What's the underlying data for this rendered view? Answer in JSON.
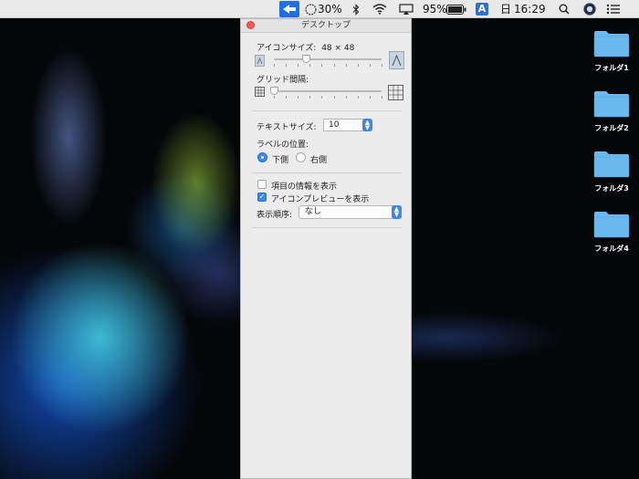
{
  "colors": {
    "accent": "#3d86e8",
    "menubar": "#e9e9e9",
    "panel": "#ececec",
    "close": "#ec5b56",
    "folder": "#6bb8f1"
  },
  "menubar": {
    "app_icon": "arrow-icon",
    "battery_percent_1": "30%",
    "bluetooth_icon": "bluetooth-icon",
    "wifi_icon": "wifi-icon",
    "airplay_icon": "airplay-icon",
    "battery_percent_2": "95%",
    "input_source": "A",
    "day": "日",
    "time": "16:29"
  },
  "panel": {
    "title": "デスクトップ",
    "icon_size_label": "アイコンサイズ:",
    "icon_size_value": "48 × 48",
    "icon_size_level": 0.3,
    "grid_spacing_label": "グリッド間隔:",
    "grid_spacing_level": 0.0,
    "text_size_label": "テキストサイズ:",
    "text_size_value": "10",
    "label_position_label": "ラベルの位置:",
    "label_position_options": [
      "下側",
      "右側"
    ],
    "label_position_selected": "下側",
    "show_item_info_label": "項目の情報を表示",
    "show_item_info_checked": false,
    "show_icon_preview_label": "アイコンプレビューを表示",
    "show_icon_preview_checked": true,
    "sort_by_label": "表示順序:",
    "sort_by_value": "なし"
  },
  "desktop": {
    "folders": [
      "フォルダ1",
      "フォルダ2",
      "フォルダ3",
      "フォルダ4"
    ]
  }
}
